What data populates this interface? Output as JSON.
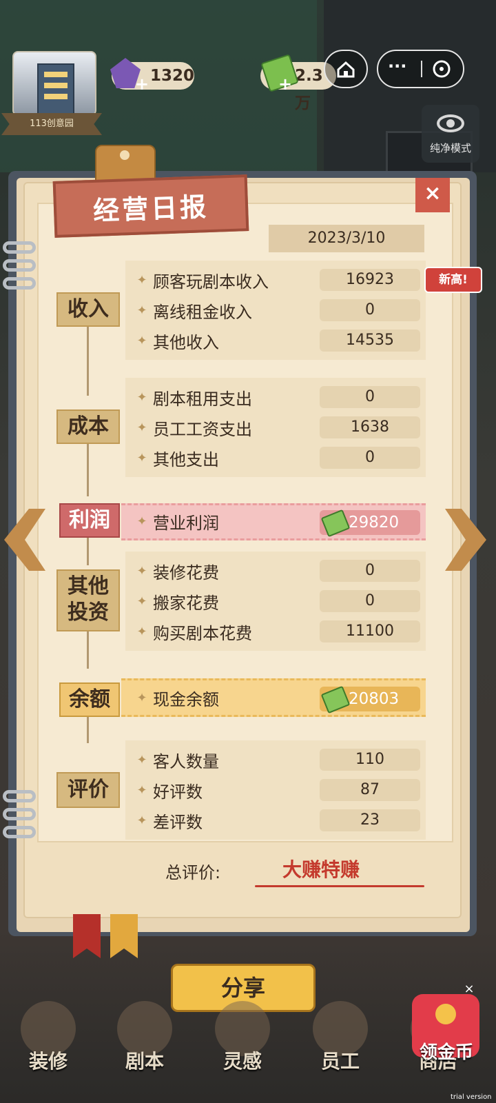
{
  "hud": {
    "building_label": "113创意园",
    "gems": "1320",
    "cash": "2.3万",
    "plus": "+",
    "mode_label": "纯净模式",
    "capsule_dots": "···"
  },
  "report": {
    "title": "经营日报",
    "close": "×",
    "date": "2023/3/10",
    "new_high_badge": "新高!",
    "income": {
      "category": "收入",
      "items": [
        {
          "label": "顾客玩剧本收入",
          "value": "16923"
        },
        {
          "label": "离线租金收入",
          "value": "0"
        },
        {
          "label": "其他收入",
          "value": "14535"
        }
      ]
    },
    "cost": {
      "category": "成本",
      "items": [
        {
          "label": "剧本租用支出",
          "value": "0"
        },
        {
          "label": "员工工资支出",
          "value": "1638"
        },
        {
          "label": "其他支出",
          "value": "0"
        }
      ]
    },
    "profit": {
      "category": "利润",
      "label": "营业利润",
      "value": "29820"
    },
    "investment": {
      "category_line1": "其他",
      "category_line2": "投资",
      "items": [
        {
          "label": "装修花费",
          "value": "0"
        },
        {
          "label": "搬家花费",
          "value": "0"
        },
        {
          "label": "购买剧本花费",
          "value": "11100"
        }
      ]
    },
    "balance": {
      "category": "余额",
      "label": "现金余额",
      "value": "20803"
    },
    "rating": {
      "category": "评价",
      "items": [
        {
          "label": "客人数量",
          "value": "110"
        },
        {
          "label": "好评数",
          "value": "87"
        },
        {
          "label": "差评数",
          "value": "23"
        }
      ]
    },
    "summary_label": "总评价:",
    "summary_value": "大赚特赚",
    "item_marker": "✦"
  },
  "share_button": "分享",
  "nav": [
    {
      "label": "装修"
    },
    {
      "label": "剧本"
    },
    {
      "label": "灵感"
    },
    {
      "label": "员工"
    },
    {
      "label": "商店"
    }
  ],
  "coin_button": "领金币",
  "close_small": "×",
  "trial": "trial version"
}
